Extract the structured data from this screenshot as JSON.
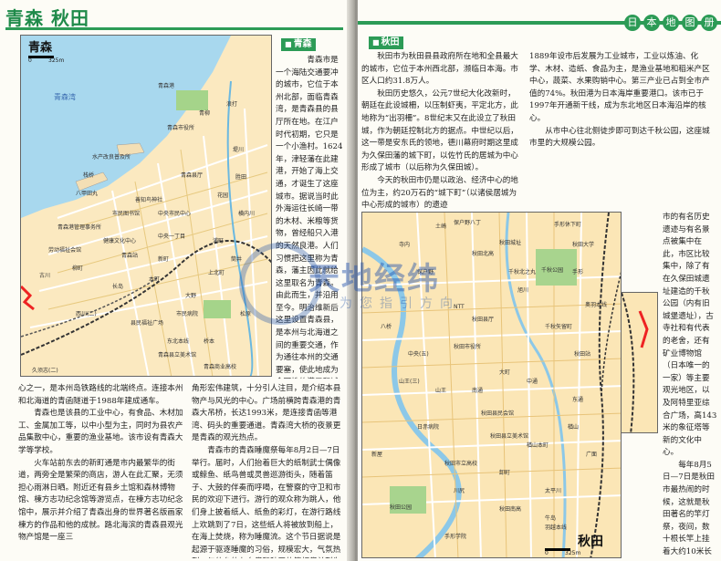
{
  "header": {
    "left_title": "青森 秋田",
    "series": [
      "日",
      "本",
      "地",
      "图",
      "册"
    ]
  },
  "aomori_map": {
    "title": "青森",
    "scale": "325m",
    "labels": [
      "青森湾",
      "青森港",
      "水产改良普及所",
      "青森市役所",
      "青森站",
      "青森县厅",
      "青森港管理事务所",
      "中央市民中心",
      "劳动福祉会馆",
      "健康文化中心",
      "市民图书馆",
      "善知鸟神社",
      "堤川",
      "浦町",
      "长岛",
      "本町",
      "西川(二)",
      "古川",
      "栈桥",
      "八甲田丸",
      "柳町",
      "中央一丁目",
      "久须志(二)",
      "东北本线",
      "上北町",
      "新町",
      "桥本",
      "县民福祉广场",
      "花园",
      "横内川",
      "浪打",
      "青森商业高校",
      "松原",
      "青柳",
      "胜田",
      "大野",
      "筒井",
      "市民病院",
      "青森县立美术馆"
    ]
  },
  "akita_map": {
    "title": "秋田",
    "scale": "325m",
    "labels": [
      "保户野八丁",
      "千秋公园",
      "手形休下町",
      "秋田城址",
      "秋田县厅",
      "秋田市役所",
      "秋田站",
      "秋田大学",
      "羽越本线",
      "奥羽本线",
      "旭川",
      "太平川",
      "楢山",
      "千秋矢留町",
      "千秋北之丸",
      "中通",
      "大町",
      "山王",
      "保户野",
      "八桥",
      "川尻",
      "新屋",
      "秋田县民会馆",
      "秋田县立美术馆",
      "日赤病院",
      "秋田公园",
      "NTT",
      "卸町",
      "东通",
      "手形",
      "广面",
      "牛岛",
      "寺内",
      "土崎",
      "中央(五)",
      "山王(三)",
      "南通",
      "楢山本町",
      "秋田市立高校",
      "秋田北高",
      "秋田南高",
      "手形学院"
    ]
  },
  "aomori_text": {
    "tag": "青森",
    "col1": "　　青森市是一个海陆交通要冲的城市，它位于本州北部，面临青森湾，是青森县的县厅所在地。在江户时代初期，它只是一个小渔村。1624年，津轻藩在此建港，开始了海上交通，才诞生了这座城市。据说当时此外海运往长崎一带的木材、米粮等货物，曾经船只入港的天然良港。人们习惯把这里称为青森，藩主因此就给这里取名为青森。由此而生，并沿用至今。明治维新后这里设置青森县，是本州与北海道之间的重要交通，作为通往本州的交通要塞，使此地成为全国性的港口和城市。后来，不断繁盛，成为日本最重要的交通要冲",
    "col_bottom_left": "心之一，是本州岛铁路线的北端终点。连接本州和北海道的青函隧道于1988年建成通车。\n　　青森也是该县的工业中心，有食品、木材加工、金属加工等，以中小型为主，同时为县农产品集散中心，重要的渔业基地。该市设有青森大学等学校。\n　　火车站前东去的新町通是市内最繁华的街道，两旁全是繁荣的商店，游人在此汇聚，无须担心雨淋日晒。附近还有县乡土馆和森林博物馆、棟方志功纪念馆等游览点，在棟方志功纪念馆中，展示并介绍了青森出身的世界著名版画家棟方的作品和他的成就。路北海滨的青森县观光物产馆是一座三",
    "col_bottom_mid": "角形宏伟建筑，十分引人注目，是介绍本县物产与风光的中心。广场前横跨青森港的青森大吊桥，长达1993米，是连接青函等港湾、码头的重要通道。青森湾大桥的夜景更是青森的观光热点。\n　　青森市的青森睡魔祭每年8月2日—7日举行。届时，人们抬着巨大的纸制武士偶像或鲸鱼、纸鸟兽或灵兽巡游街头，随着笛子、大鼓的伴奏而呼喝，在警察的守卫和市民的欢迎下进行。游行的观众称为跳人，他们身上披着纸人、纸鱼的彩灯，在游行路线上欢跳到了7日，这些纸人将被放到船上，在海上焚烧，称为睡魔流。这个节日据说是起源于驱逐睡魔的习俗，规模宏大，气氛热烈，与仙台的七夕祭和秋田的竿灯祭并列为东北三大祭。"
  },
  "akita_text": {
    "tag": "秋田",
    "col1": "　　秋田市为秋田县县政府所在地和全县最大的城市，它位于本州西北部，濒临日本海。市区人口约31.8万人。\n　　秋田历史悠久，公元7世纪大化改新时，朝廷在此设城柵，以压制虾夷，平定北方，此地称为“出羽柵”。8世纪末又在此设立了秋田城，作为朝廷控制北方的据点。中世纪以后，这一带是安东氏的领地，德川幕府时期这里成为久保田藩的城下町，以佐竹氏的居城为中心形成了城市（以后称为久保田城）。\n　　今天的秋田市仍是以政治、经济中心的地位为主，约20万石的“城下町”（以诸侯居城为中心形成的城市）的遗迹",
    "col2": "1889年设市后发展为工业城市，工业以炼油、化学、木材、造纸、食品为主，是渔业基地和稻米产区中心，蔬菜、水果购销中心。第三产业已占到全市产值的74%。秋田港为日本海岸重要港口。该市已于1997年开通新干线，成为东北地区日本海沿岸的核心。\n　　从市中心往北侧徒步即可到达千秋公园，这座城市里的大规模公园。",
    "col3": "市的有名历史遗迹与有名景点被集中在此，市区比较集中，除了有在久保田城遗址建造的千秋公园（内有旧城堡遗址），古寺社和有代表的老舍，还有矿业博物馆（日本唯一的一家）等主要观光地区，以及阿特里亚综合广场，高143米的象征塔等新的文化中心。\n　　每年8月5日—7日是秋田市最热闹的时候，这就是秋田著名的竿灯祭，夜间，数十根长竿上挂着大约10米长的灯笼，同时竖起成千个灯笼，人们一面吹笛击鼓，一面把它们高高举起。竿灯以手掌、额头、肩膀、腰部支撑，令人惊叹。竿灯祭是东北三大祭之一。在秋田市民俗艺能传承馆，有介绍这些活动的资料或录像。"
  },
  "watermark": {
    "main": "天地经纬",
    "sub": "为您指引方向"
  }
}
